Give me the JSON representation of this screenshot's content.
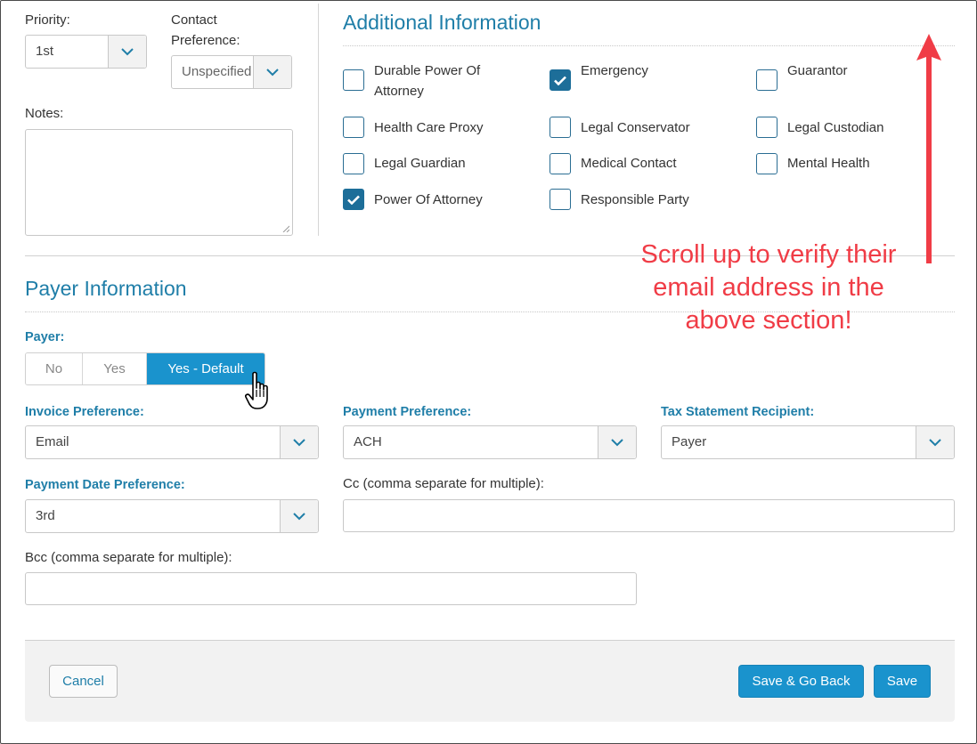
{
  "contact": {
    "priority_label": "Priority:",
    "priority_value": "1st",
    "contact_pref_label": "Contact Preference:",
    "contact_pref_value": "Unspecified",
    "notes_label": "Notes:"
  },
  "additional": {
    "title": "Additional Information",
    "checkboxes": [
      {
        "label": "Durable Power Of Attorney",
        "checked": false
      },
      {
        "label": "Emergency",
        "checked": true
      },
      {
        "label": "Guarantor",
        "checked": false
      },
      {
        "label": "Health Care Proxy",
        "checked": false
      },
      {
        "label": "Legal Conservator",
        "checked": false
      },
      {
        "label": "Legal Custodian",
        "checked": false
      },
      {
        "label": "Legal Guardian",
        "checked": false
      },
      {
        "label": "Medical Contact",
        "checked": false
      },
      {
        "label": "Mental Health",
        "checked": false
      },
      {
        "label": "Power Of Attorney",
        "checked": true
      },
      {
        "label": "Responsible Party",
        "checked": false
      }
    ]
  },
  "payer": {
    "title": "Payer Information",
    "payer_label": "Payer:",
    "options": [
      "No",
      "Yes",
      "Yes - Default"
    ],
    "selected": "Yes - Default",
    "invoice_label": "Invoice Preference:",
    "invoice_value": "Email",
    "payment_label": "Payment Preference:",
    "payment_value": "ACH",
    "tax_label": "Tax Statement Recipient:",
    "tax_value": "Payer",
    "date_label": "Payment Date Preference:",
    "date_value": "3rd",
    "cc_label": "Cc (comma separate for multiple):",
    "bcc_label": "Bcc (comma separate for multiple):"
  },
  "footer": {
    "cancel": "Cancel",
    "save_back": "Save & Go Back",
    "save": "Save"
  },
  "annotation": {
    "lines": [
      "Scroll up to verify their",
      "email address in the",
      "above section!"
    ],
    "color": "#f03c46"
  },
  "colors": {
    "accent": "#1a93cd",
    "heading": "#1f7ea8"
  }
}
